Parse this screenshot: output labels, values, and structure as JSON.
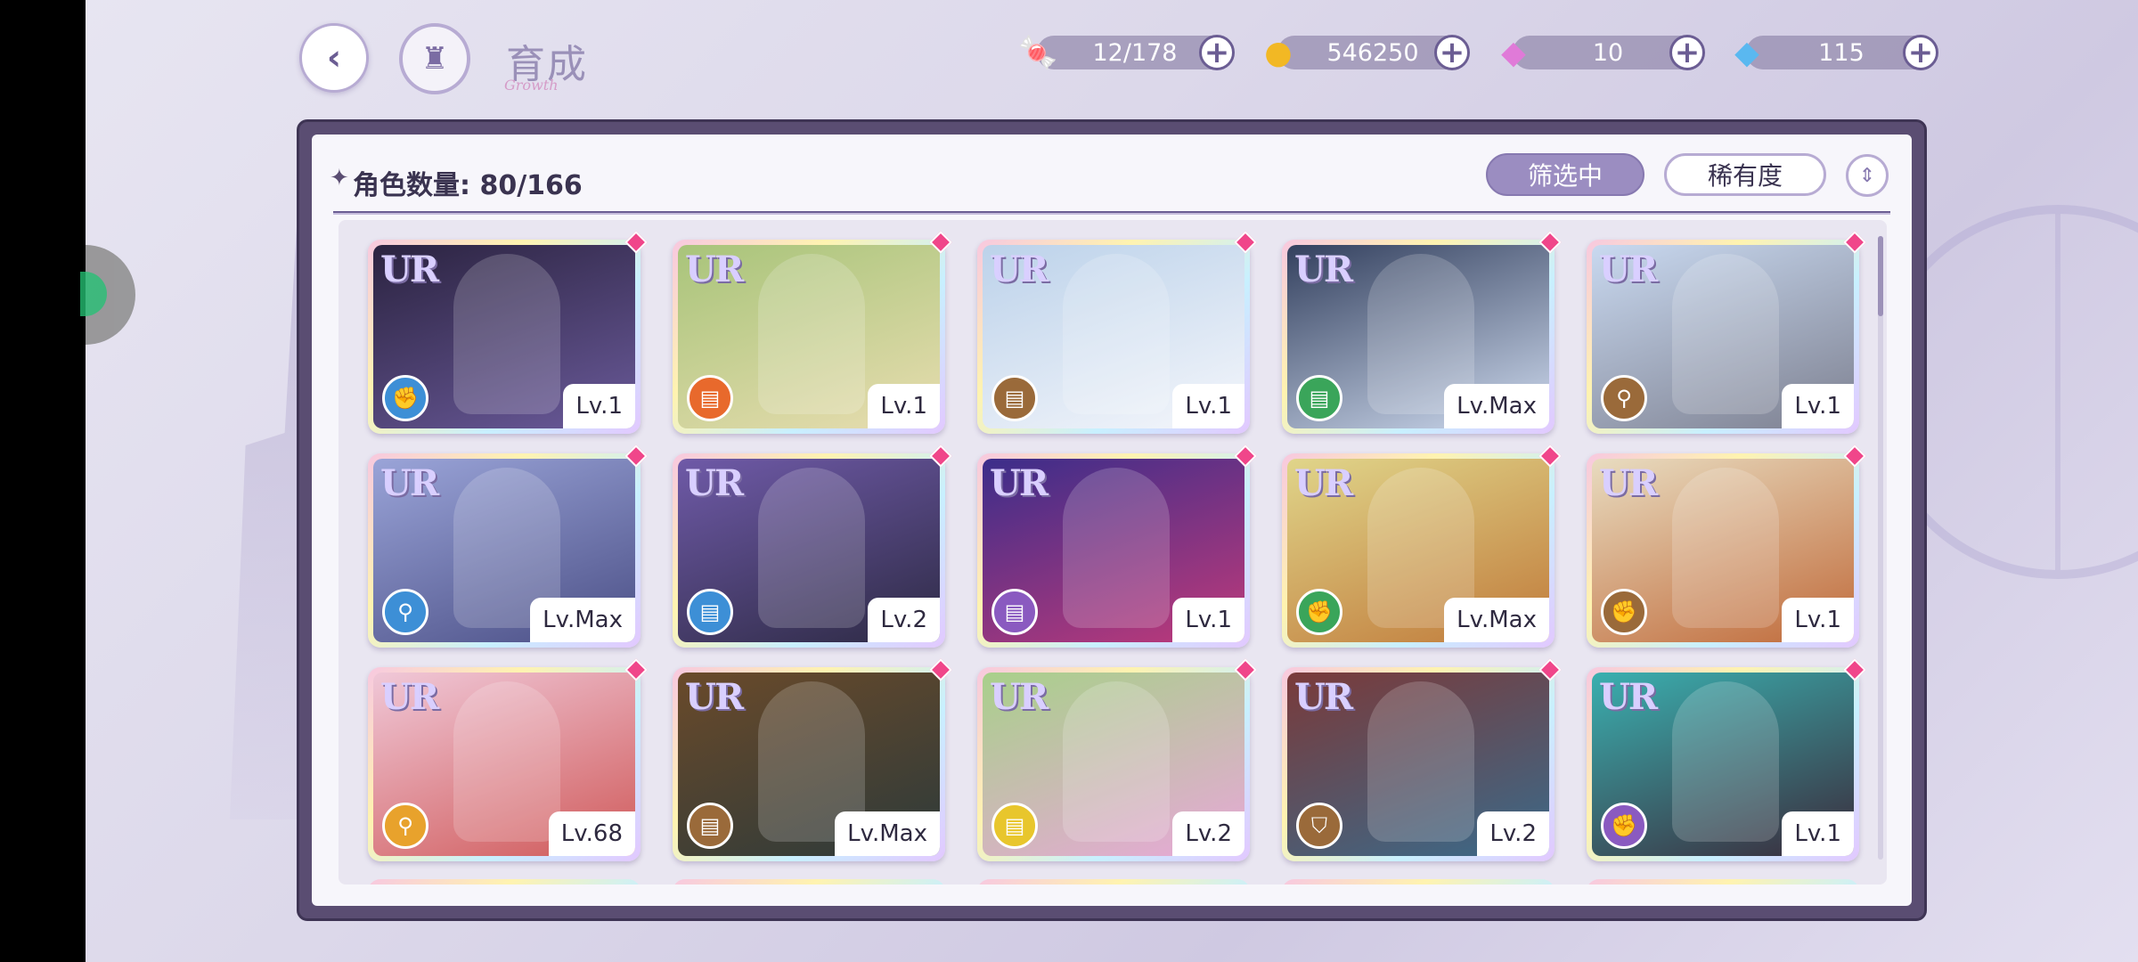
{
  "header": {
    "title": "育成",
    "subtitle": "Growth",
    "back_icon": "back-arrow-icon",
    "home_icon": "castle-home-icon"
  },
  "currencies": [
    {
      "name": "candy",
      "icon": "candy-icon",
      "value": "12/178"
    },
    {
      "name": "gold-coin",
      "icon": "coin-icon",
      "value": "546250"
    },
    {
      "name": "pink-diamond",
      "icon": "pink-diamond-icon",
      "value": "10"
    },
    {
      "name": "blue-diamond",
      "icon": "blue-diamond-icon",
      "value": "115"
    }
  ],
  "panel": {
    "count_label": "角色数量:",
    "count_value": "80/166",
    "filter_label": "筛选中",
    "sort_label": "稀有度"
  },
  "cards": [
    {
      "rarity": "UR",
      "level": "Lv.1",
      "type_color": "#3d8fd6",
      "type_icon": "fist-icon",
      "art": [
        "#2b2340",
        "#6a5a9a"
      ]
    },
    {
      "rarity": "UR",
      "level": "Lv.1",
      "type_color": "#e8692c",
      "type_icon": "book-icon",
      "art": [
        "#a8c47a",
        "#e8ddb0"
      ]
    },
    {
      "rarity": "UR",
      "level": "Lv.1",
      "type_color": "#9a6a3a",
      "type_icon": "book-icon",
      "art": [
        "#bcd2ea",
        "#f4f6fb"
      ]
    },
    {
      "rarity": "UR",
      "level": "Lv.Max",
      "type_color": "#3aa55a",
      "type_icon": "book-icon",
      "art": [
        "#33405e",
        "#cfdbef"
      ]
    },
    {
      "rarity": "UR",
      "level": "Lv.1",
      "type_color": "#9a6a3a",
      "type_icon": "staff-icon",
      "art": [
        "#c9d9f0",
        "#7d8090"
      ]
    },
    {
      "rarity": "UR",
      "level": "Lv.Max",
      "type_color": "#3d8fd6",
      "type_icon": "staff-icon",
      "art": [
        "#9aa4d8",
        "#4b4f86"
      ]
    },
    {
      "rarity": "UR",
      "level": "Lv.2",
      "type_color": "#3d8fd6",
      "type_icon": "book-icon",
      "art": [
        "#6f5aa8",
        "#2d2a44"
      ]
    },
    {
      "rarity": "UR",
      "level": "Lv.1",
      "type_color": "#8a5ac0",
      "type_icon": "book-icon",
      "art": [
        "#3b2d8a",
        "#c03a7a"
      ]
    },
    {
      "rarity": "UR",
      "level": "Lv.Max",
      "type_color": "#3aa55a",
      "type_icon": "fist-icon",
      "art": [
        "#e0d58a",
        "#c07a3a"
      ]
    },
    {
      "rarity": "UR",
      "level": "Lv.1",
      "type_color": "#9a6a3a",
      "type_icon": "fist-icon",
      "art": [
        "#e8dcc0",
        "#c06a3a"
      ]
    },
    {
      "rarity": "UR",
      "level": "Lv.68",
      "type_color": "#e8a22c",
      "type_icon": "staff-icon",
      "art": [
        "#f0c8d8",
        "#d05a5a"
      ]
    },
    {
      "rarity": "UR",
      "level": "Lv.Max",
      "type_color": "#9a6a3a",
      "type_icon": "book-icon",
      "art": [
        "#6a4a2a",
        "#2d3a3a"
      ]
    },
    {
      "rarity": "UR",
      "level": "Lv.2",
      "type_color": "#e8c62c",
      "type_icon": "book-icon",
      "art": [
        "#a8d08a",
        "#e8a8d8"
      ]
    },
    {
      "rarity": "UR",
      "level": "Lv.2",
      "type_color": "#9a6a3a",
      "type_icon": "shield-icon",
      "art": [
        "#7a3a3a",
        "#3a6a8a"
      ]
    },
    {
      "rarity": "UR",
      "level": "Lv.1",
      "type_color": "#8a5ac0",
      "type_icon": "fist-icon",
      "art": [
        "#3ab0b0",
        "#3a2a3a"
      ]
    }
  ]
}
